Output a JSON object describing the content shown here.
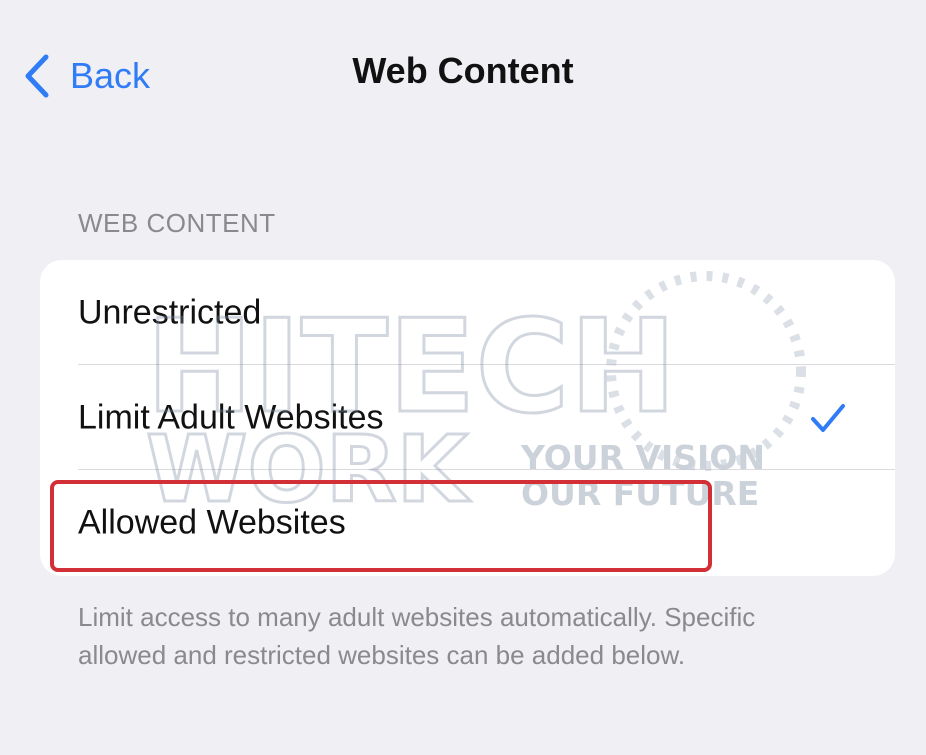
{
  "nav": {
    "back_label": "Back",
    "title": "Web Content"
  },
  "section": {
    "header": "WEB CONTENT",
    "options": [
      {
        "label": "Unrestricted",
        "selected": false
      },
      {
        "label": "Limit Adult Websites",
        "selected": true
      },
      {
        "label": "Allowed Websites",
        "selected": false
      }
    ],
    "footer": "Limit access to many adult websites automatically. Specific allowed and restricted websites can be added below."
  },
  "watermark": {
    "line1": "HITECH",
    "line2": "WORK",
    "tagline1": "YOUR VISION",
    "tagline2": "OUR FUTURE"
  },
  "colors": {
    "accent": "#2f7cf6",
    "background": "#f0eff4",
    "highlight": "#d32f36",
    "secondary_text": "#8a8a8e"
  }
}
